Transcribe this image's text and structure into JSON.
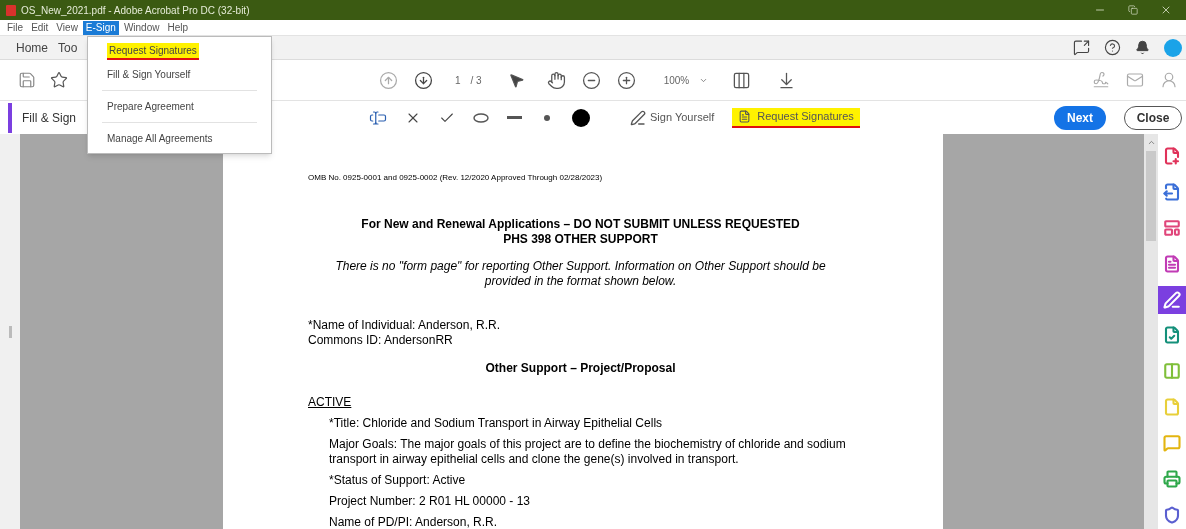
{
  "window": {
    "title": "OS_New_2021.pdf - Adobe Acrobat Pro DC (32-bit)"
  },
  "menu_bar": [
    {
      "label": "File",
      "selected": false
    },
    {
      "label": "Edit",
      "selected": false
    },
    {
      "label": "View",
      "selected": false
    },
    {
      "label": "E-Sign",
      "selected": true
    },
    {
      "label": "Window",
      "selected": false
    },
    {
      "label": "Help",
      "selected": false
    }
  ],
  "menu": {
    "items": [
      {
        "label": "Request Signatures",
        "highlighted": true
      },
      {
        "label": "Fill & Sign Yourself",
        "highlighted": false
      },
      {
        "label": "Prepare Agreement",
        "highlighted": false
      },
      {
        "label": "Manage All Agreements",
        "highlighted": false
      }
    ]
  },
  "tabs": [
    {
      "label": "Home",
      "selected": false
    },
    {
      "label": "Too",
      "selected": false
    }
  ],
  "toolbar": {
    "page": "1",
    "page_total": "/ 3",
    "zoom": "100%"
  },
  "fill_sign": {
    "title": "Fill & Sign",
    "sign_yourself": "Sign Yourself",
    "request_signatures": {
      "label": "Request Signatures",
      "highlighted": true
    },
    "next": "Next",
    "close": "Close"
  },
  "document": {
    "header": "OMB No. 0925-0001 and 0925-0002 (Rev. 12/2020 Approved Through 02/28/2023)",
    "title_lines": [
      "For New and Renewal Applications – DO NOT SUBMIT UNLESS REQUESTED",
      "PHS 398 OTHER SUPPORT"
    ],
    "note": "There is no \"form page\" for reporting Other Support. Information on Other Support should be provided in the format shown below.",
    "individual": [
      "*Name of Individual: Anderson, R.R.",
      "Commons ID: AndersonRR"
    ],
    "section_title": "Other Support – Project/Proposal",
    "status_heading": "ACTIVE",
    "entries": [
      "*Title: Chloride and Sodium Transport in Airway Epithelial Cells",
      "Major Goals: The major goals of this project are to define the biochemistry of chloride and sodium transport in airway epithelial cells and clone the gene(s) involved in transport.",
      "*Status of Support: Active",
      "Project Number: 2 R01 HL 00000 - 13",
      "Name of PD/PI: Anderson, R.R."
    ]
  },
  "tools_panel": [
    {
      "color": "#e0325a",
      "selected": false
    },
    {
      "color": "#3b6fd8",
      "selected": false
    },
    {
      "color": "#e0457a",
      "selected": false
    },
    {
      "color": "#c13bb5",
      "selected": false
    },
    {
      "color": "#ffffff",
      "selected": true
    },
    {
      "color": "#14907a",
      "selected": false
    },
    {
      "color": "#7fbf3a",
      "selected": false
    },
    {
      "color": "#e8cf3a",
      "selected": false
    },
    {
      "color": "#e3b510",
      "selected": false
    },
    {
      "color": "#2ea84a",
      "selected": false
    },
    {
      "color": "#5a5fd0",
      "selected": false
    }
  ]
}
